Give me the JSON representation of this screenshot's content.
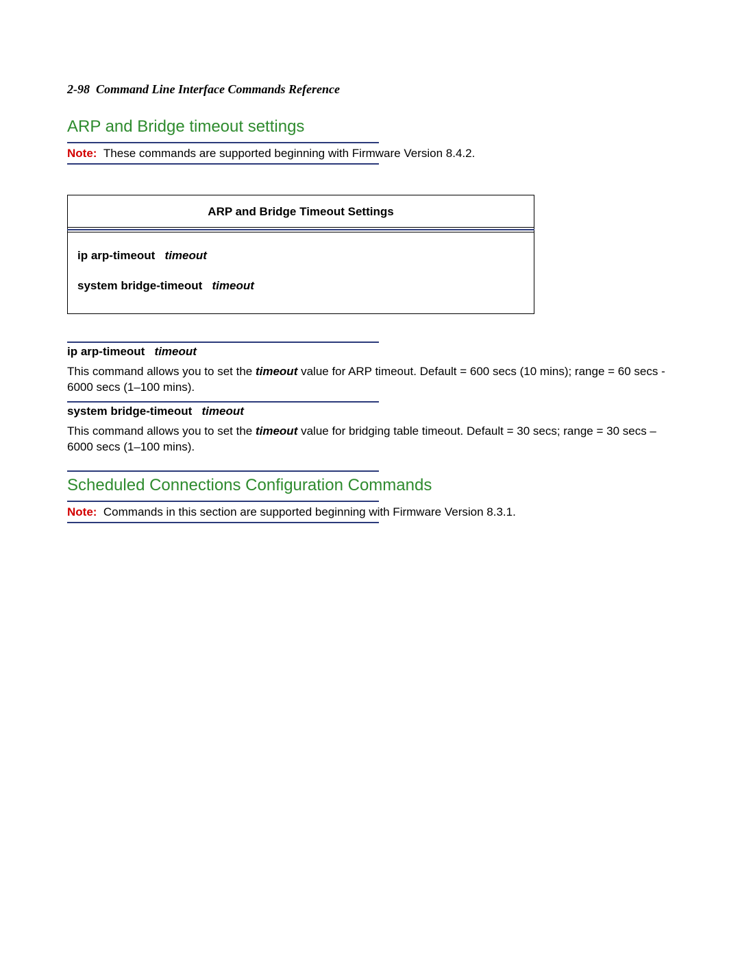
{
  "runningHead": {
    "pageRef": "2-98",
    "title": "Command Line Interface Commands Reference"
  },
  "section1": {
    "title": "ARP and Bridge timeout settings",
    "note": {
      "label": "Note:",
      "text": "These commands are supported beginning with Firmware Version 8.4.2."
    },
    "box": {
      "title": "ARP and Bridge Timeout Settings",
      "commands": [
        {
          "cmd": "ip arp-timeout",
          "arg": "timeout"
        },
        {
          "cmd": "system bridge-timeout",
          "arg": "timeout"
        }
      ]
    },
    "details": [
      {
        "heading": {
          "cmd": "ip arp-timeout",
          "arg": "timeout"
        },
        "pre": "This command allows you to set the ",
        "emph": "timeout",
        "post": " value for ARP timeout. Default = 600 secs (10 mins); range = 60 secs - 6000 secs (1–100 mins)."
      },
      {
        "heading": {
          "cmd": "system bridge-timeout",
          "arg": "timeout"
        },
        "pre": "This command allows you to set the ",
        "emph": "timeout",
        "post": " value for bridging table timeout. Default = 30 secs; range = 30 secs – 6000 secs (1–100 mins)."
      }
    ]
  },
  "section2": {
    "title": "Scheduled Connections Configuration Commands",
    "note": {
      "label": "Note:",
      "text": "Commands in this section are supported beginning with Firmware Version 8.3.1."
    }
  }
}
